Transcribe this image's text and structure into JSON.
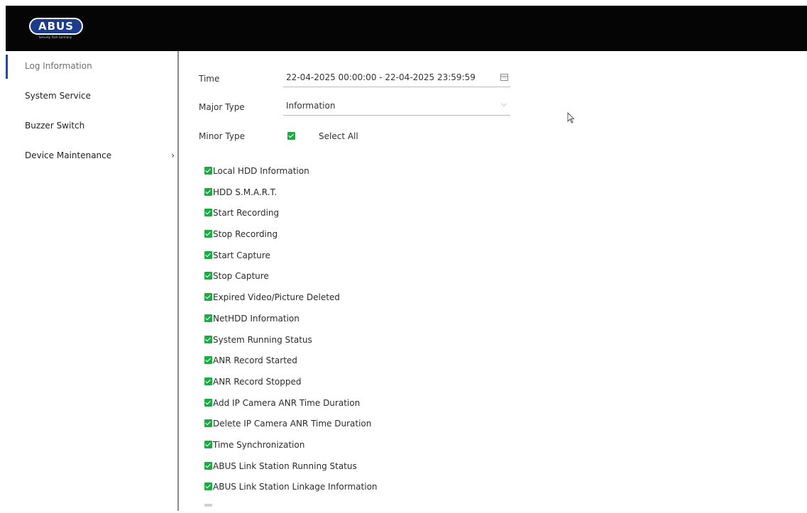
{
  "header": {
    "logo_text": "ABUS",
    "logo_tagline": "Security Tech Germany",
    "background_color": "#050505",
    "logo_color": "#1e3c8c"
  },
  "sidebar": {
    "items": [
      {
        "label": "Log Information",
        "active": true
      },
      {
        "label": "System Service",
        "active": false
      },
      {
        "label": "Buzzer Switch",
        "active": false
      },
      {
        "label": "Device Maintenance",
        "active": false,
        "has_submenu": true,
        "chevron": "›"
      }
    ]
  },
  "form": {
    "time_label": "Time",
    "time_value": "22-04-2025 00:00:00 - 22-04-2025 23:59:59",
    "major_type_label": "Major Type",
    "major_type_value": "Information",
    "minor_type_label": "Minor Type",
    "select_all_label": "Select All",
    "select_all_checked": true
  },
  "minor_types": [
    {
      "label": "Local HDD Information",
      "checked": true
    },
    {
      "label": "HDD S.M.A.R.T.",
      "checked": true
    },
    {
      "label": "Start Recording",
      "checked": true
    },
    {
      "label": "Stop Recording",
      "checked": true
    },
    {
      "label": "Start Capture",
      "checked": true
    },
    {
      "label": "Stop Capture",
      "checked": true
    },
    {
      "label": "Expired Video/Picture Deleted",
      "checked": true
    },
    {
      "label": "NetHDD Information",
      "checked": true
    },
    {
      "label": "System Running Status",
      "checked": true
    },
    {
      "label": "ANR Record Started",
      "checked": true
    },
    {
      "label": "ANR Record Stopped",
      "checked": true
    },
    {
      "label": "Add IP Camera ANR Time Duration",
      "checked": true
    },
    {
      "label": "Delete IP Camera ANR Time Duration",
      "checked": true
    },
    {
      "label": "Time Synchronization",
      "checked": true
    },
    {
      "label": "ABUS Link Station Running Status",
      "checked": true
    },
    {
      "label": "ABUS Link Station Linkage Information",
      "checked": true
    }
  ],
  "colors": {
    "checkbox_checked": "#1faa45",
    "active_indicator": "#2a4a96"
  },
  "icons": {
    "calendar": "calendar-icon",
    "dropdown": "chevron-down-icon",
    "checkbox": "checkbox-checked-icon",
    "cursor": "mouse-pointer-icon"
  }
}
